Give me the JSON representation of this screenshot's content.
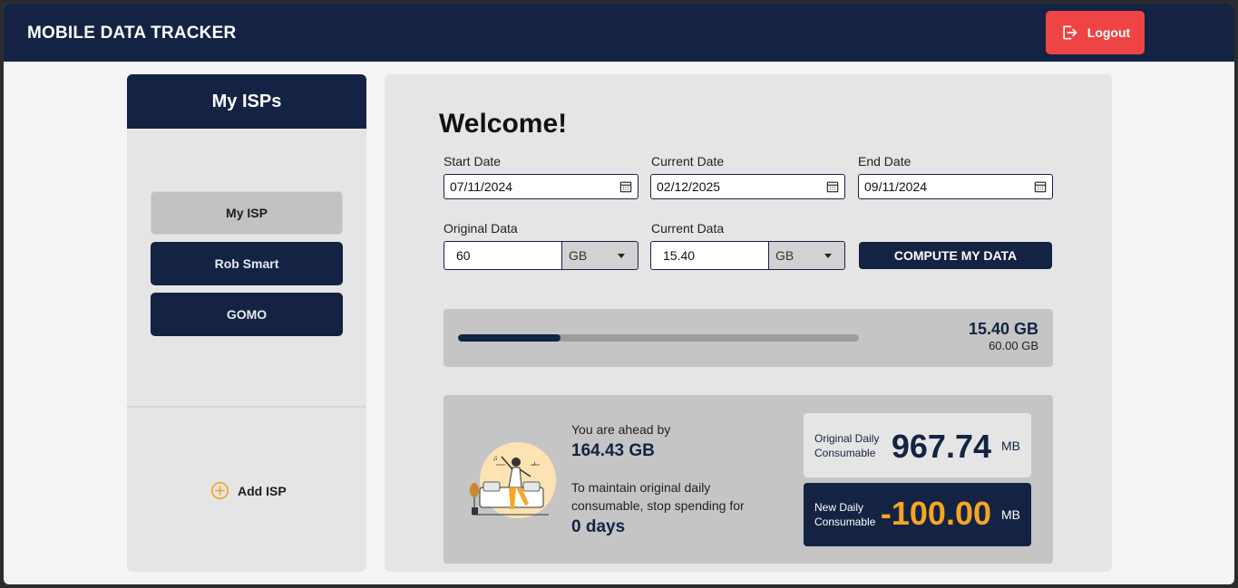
{
  "header": {
    "title": "MOBILE DATA TRACKER",
    "logout_label": "Logout"
  },
  "sidebar": {
    "title": "My ISPs",
    "items": [
      {
        "label": "My ISP",
        "active": true
      },
      {
        "label": "Rob Smart",
        "active": false
      },
      {
        "label": "GOMO",
        "active": false
      }
    ],
    "add_label": "Add ISP"
  },
  "main": {
    "welcome": "Welcome!",
    "start_date": {
      "label": "Start Date",
      "value": "07/11/2024"
    },
    "current_date": {
      "label": "Current Date",
      "value": "02/12/2025"
    },
    "end_date": {
      "label": "End Date",
      "value": "09/11/2024"
    },
    "original_data": {
      "label": "Original Data",
      "value": "60",
      "unit": "GB"
    },
    "current_data": {
      "label": "Current Data",
      "value": "15.40",
      "unit": "GB"
    },
    "compute_label": "COMPUTE MY DATA",
    "progress": {
      "current": "15.40 GB",
      "total": "60.00 GB",
      "fraction": 0.2567
    },
    "stats": {
      "ahead_label": "You are ahead by",
      "ahead_value": "164.43 GB",
      "maintain_text": "To maintain original daily consumable, stop spending for",
      "days_value": "0 days",
      "original_daily_label": "Original Daily Consumable",
      "original_daily_value": "967.74",
      "original_daily_unit": "MB",
      "new_daily_label": "New Daily Consumable",
      "new_daily_value": "-100.00",
      "new_daily_unit": "MB"
    }
  },
  "colors": {
    "navy": "#142343",
    "logout_red": "#ef4444",
    "accent_orange": "#f5a623"
  }
}
